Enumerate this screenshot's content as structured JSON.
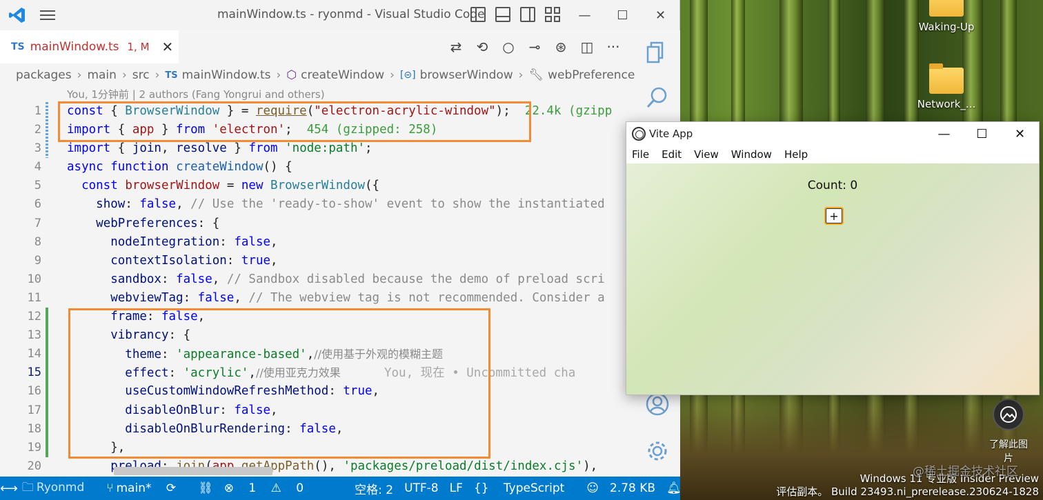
{
  "vscode": {
    "window_title": "mainWindow.ts - ryonmd - Visual Studio Code",
    "tab": {
      "lang_badge": "TS",
      "name": "mainWindow.ts",
      "status": "1, M"
    },
    "breadcrumb": [
      "packages",
      "main",
      "src",
      "mainWindow.ts",
      "createWindow",
      "browserWindow",
      "webPreferences"
    ],
    "breadcrumb_ts_badge": "TS",
    "blame_text": "You, 1分钟前 | 2 authors (Fang Yongrui and others)",
    "line_numbers": [
      "1",
      "2",
      "3",
      "4",
      "5",
      "6",
      "7",
      "8",
      "9",
      "10",
      "11",
      "12",
      "13",
      "14",
      "15",
      "16",
      "17",
      "18",
      "19",
      "20"
    ],
    "active_line": "15",
    "code": {
      "l1": {
        "a": "const",
        "b": " { ",
        "c": "BrowserWindow",
        "d": " } = ",
        "e": "require",
        "f": "(",
        "g": "\"electron-acrylic-window\"",
        "h": ");",
        "i": "  22.4k (gzipp"
      },
      "l2": {
        "a": "import",
        "b": " { ",
        "c": "app",
        "d": " } ",
        "e": "from",
        "f": " ",
        "g": "'electron'",
        "h": ";",
        "i": "  454 (gzipped: 258)"
      },
      "l3": {
        "a": "import",
        "b": " { ",
        "c": "join",
        "d": ", ",
        "e": "resolve",
        "f": " } ",
        "g": "from",
        "h": " ",
        "i": "'node:path'",
        "j": ";"
      },
      "l4": {
        "a": "async",
        "b": " ",
        "c": "function",
        "d": " ",
        "e": "createWindow",
        "f": "() {"
      },
      "l5": {
        "a": "  ",
        "b": "const",
        "c": " ",
        "d": "browserWindow",
        "e": " = ",
        "f": "new",
        "g": " ",
        "h": "BrowserWindow",
        "i": "({"
      },
      "l6": {
        "a": "    ",
        "b": "show",
        "c": ": ",
        "d": "false",
        "e": ", ",
        "f": "// Use the 'ready-to-show' event to show the instantiated"
      },
      "l7": {
        "a": "    ",
        "b": "webPreferences",
        "c": ": {"
      },
      "l8": {
        "a": "      ",
        "b": "nodeIntegration",
        "c": ": ",
        "d": "false",
        "e": ","
      },
      "l9": {
        "a": "      ",
        "b": "contextIsolation",
        "c": ": ",
        "d": "true",
        "e": ","
      },
      "l10": {
        "a": "      ",
        "b": "sandbox",
        "c": ": ",
        "d": "false",
        "e": ", ",
        "f": "// Sandbox disabled because the demo of preload scri"
      },
      "l11": {
        "a": "      ",
        "b": "webviewTag",
        "c": ": ",
        "d": "false",
        "e": ", ",
        "f": "// The webview tag is not recommended. Consider a"
      },
      "l12": {
        "a": "      ",
        "b": "frame",
        "c": ": ",
        "d": "false",
        "e": ","
      },
      "l13": {
        "a": "      ",
        "b": "vibrancy",
        "c": ": {"
      },
      "l14": {
        "a": "        ",
        "b": "theme",
        "c": ": ",
        "d": "'appearance-based'",
        "e": ",",
        "f": "//使用基于外观的模糊主题"
      },
      "l15": {
        "a": "        ",
        "b": "effect",
        "c": ": ",
        "d": "'acrylic'",
        "e": ",",
        "f": "//使用亚克力效果",
        "g": "      You, 现在 • Uncommitted cha"
      },
      "l16": {
        "a": "        ",
        "b": "useCustomWindowRefreshMethod",
        "c": ": ",
        "d": "true",
        "e": ","
      },
      "l17": {
        "a": "        ",
        "b": "disableOnBlur",
        "c": ": ",
        "d": "false",
        "e": ","
      },
      "l18": {
        "a": "        ",
        "b": "disableOnBlurRendering",
        "c": ": ",
        "d": "false",
        "e": ","
      },
      "l19": {
        "a": "      },"
      },
      "l20": {
        "a": "      ",
        "b": "preload",
        "c": ": ",
        "d": "join",
        "e": "(",
        "f": "app",
        "g": ".",
        "h": "getAppPath",
        "i": "(), ",
        "j": "'packages/preload/dist/index.cjs'",
        "k": "),"
      }
    },
    "status_bar": {
      "remote": "⟷",
      "project": "Ryonmd",
      "branch": "main*",
      "sync": "⟳",
      "errors": "1",
      "warnings": "0",
      "indent": "空格: 2",
      "encoding": "UTF-8",
      "eol": "LF",
      "language": "TypeScript",
      "file_size": "2.78 KB"
    }
  },
  "desktop": {
    "icons": [
      "Waking-Up",
      "Network_..."
    ],
    "learn_more": "了解此图片",
    "watermark_line1": "Windows 11 专业版 Insider Preview",
    "watermark_line2": "评估副本。 Build 23493.ni_prerelease.230624-1828",
    "juejin": "@稀土掘金技术社区"
  },
  "vite_app": {
    "title": "Vite App",
    "menu": [
      "File",
      "Edit",
      "View",
      "Window",
      "Help"
    ],
    "count_label": "Count: 0",
    "plus_label": "+"
  },
  "colors": {
    "accent": "#007acc",
    "highlight_box": "#f58a34",
    "error_tab": "#c72e2e"
  }
}
